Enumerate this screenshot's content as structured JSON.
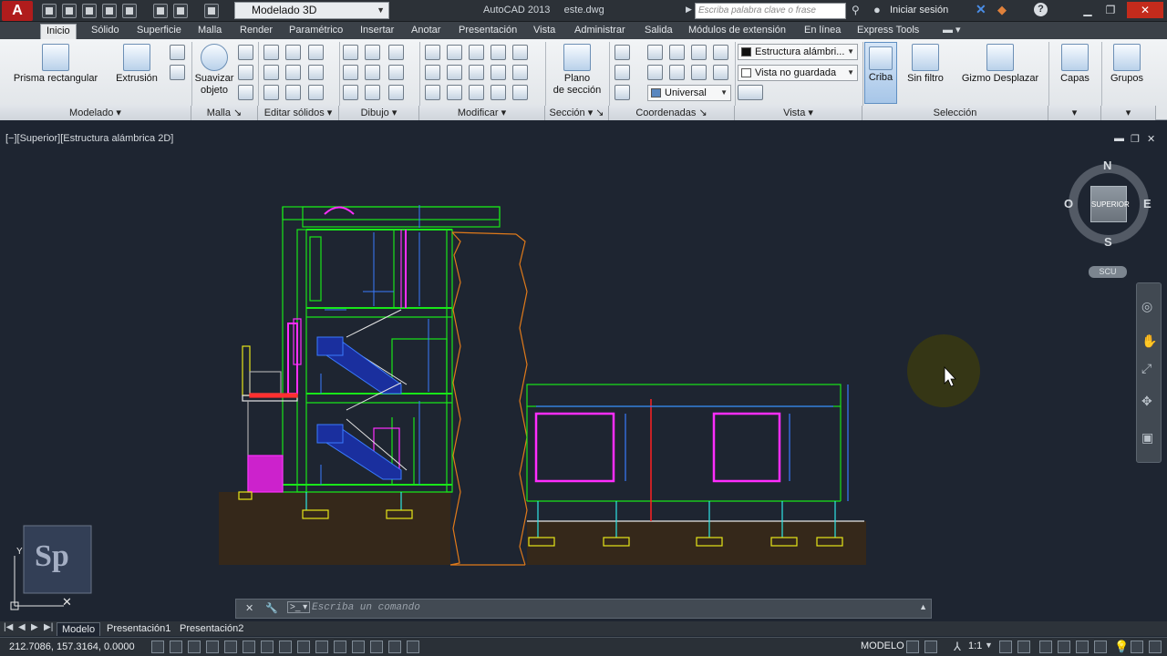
{
  "titlebar": {
    "workspace": "Modelado 3D",
    "app_title": "AutoCAD 2013",
    "file_name": "este.dwg",
    "search_placeholder": "Escriba palabra clave o frase",
    "login": "Iniciar sesión"
  },
  "ribbon_tabs": [
    "Inicio",
    "Sólido",
    "Superficie",
    "Malla",
    "Render",
    "Paramétrico",
    "Insertar",
    "Anotar",
    "Presentación",
    "Vista",
    "Administrar",
    "Salida",
    "Módulos de extensión",
    "En línea",
    "Express Tools"
  ],
  "active_tab": "Inicio",
  "ribbon": {
    "modelado": {
      "prisma": "Prisma rectangular",
      "extrusion": "Extrusión",
      "panel": "Modelado"
    },
    "malla": {
      "suavizar_1": "Suavizar",
      "suavizar_2": "objeto",
      "panel": "Malla"
    },
    "editar_solidos": {
      "panel": "Editar sólidos"
    },
    "dibujo": {
      "panel": "Dibujo"
    },
    "modificar": {
      "panel": "Modificar"
    },
    "seccion": {
      "plano_1": "Plano",
      "plano_2": "de sección",
      "panel": "Sección"
    },
    "coordenadas": {
      "ucs_value": "Universal",
      "panel": "Coordenadas"
    },
    "vista": {
      "visual_style": "Estructura alámbri...",
      "named_view": "Vista no guardada",
      "panel": "Vista"
    },
    "seleccion": {
      "criba": "Criba",
      "sin_filtro": "Sin filtro",
      "gizmo": "Gizmo Desplazar",
      "panel": "Selección"
    },
    "capas": "Capas",
    "grupos": "Grupos"
  },
  "viewport": {
    "label": "[−][Superior][Estructura alámbrica 2D]",
    "viewcube": {
      "north": "N",
      "south": "S",
      "east": "E",
      "west": "O",
      "face": "SUPERIOR",
      "ucs": "SCU"
    }
  },
  "command_line": {
    "placeholder": "Escriba un comando"
  },
  "layout_tabs": [
    "Modelo",
    "Presentación1",
    "Presentación2"
  ],
  "active_layout": "Modelo",
  "statusbar": {
    "coords": "212.7086, 157.3164, 0.0000",
    "space": "MODELO",
    "scale": "1:1"
  },
  "colors": {
    "background": "#1e2531",
    "dim": "#3a7bff",
    "wall": "#19e619",
    "magenta": "#ff2dff",
    "orange": "#e07a1a",
    "yellow": "#e6e619",
    "soil": "#3b2a14",
    "cyan": "#2ee6e6"
  }
}
